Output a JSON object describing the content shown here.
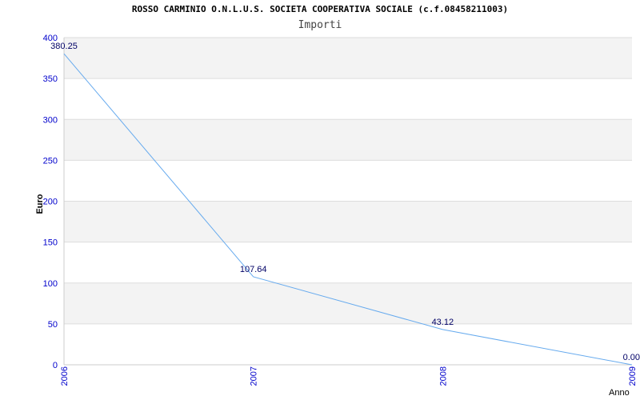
{
  "chart_data": {
    "type": "line",
    "title": "ROSSO CARMINIO O.N.L.U.S. SOCIETA COOPERATIVA SOCIALE (c.f.08458211003)",
    "subtitle": "Importi",
    "xlabel": "Anno",
    "ylabel": "Euro",
    "x": [
      "2006",
      "2007",
      "2008",
      "2009"
    ],
    "values": [
      380.25,
      107.64,
      43.12,
      0.0
    ],
    "data_labels": [
      "380.25",
      "107.64",
      "43.12",
      "0.00"
    ],
    "ylim": [
      0,
      400
    ],
    "yticks": [
      0,
      50,
      100,
      150,
      200,
      250,
      300,
      350,
      400
    ],
    "grid": true,
    "colors": {
      "line": "#66aaee",
      "band": "#f3f3f3",
      "grid": "#dddddd",
      "tick_text": "#0000cc",
      "label_text": "#000066"
    }
  }
}
